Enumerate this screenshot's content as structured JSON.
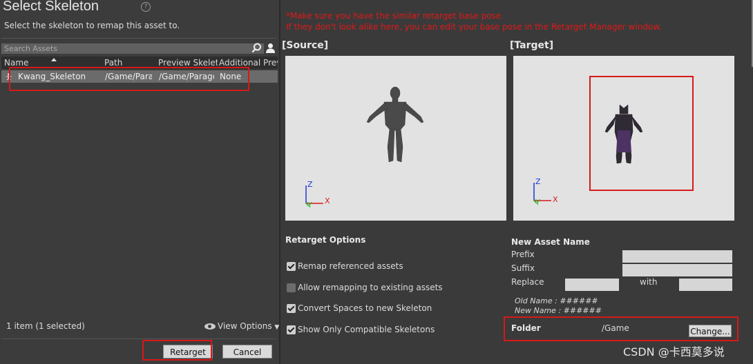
{
  "dialog": {
    "title": "Select Skeleton",
    "help_icon": "help-icon",
    "subtitle": "Select the skeleton to remap this asset to."
  },
  "search": {
    "placeholder": "Search Assets",
    "icon": "search-icon",
    "filter_icon": "person-icon"
  },
  "table": {
    "columns": [
      "Name",
      "Path",
      "Preview Skeleta",
      "Additional Prev"
    ],
    "rows": [
      {
        "name": "Kwang_Skeleton",
        "path": "/Game/Para",
        "preview": "/Game/Parago",
        "additional": "None",
        "selected": true
      }
    ]
  },
  "footer": {
    "count_text": "1 item (1 selected)",
    "view_options": "View Options",
    "retarget": "Retarget",
    "cancel": "Cancel"
  },
  "warnings": [
    "*Make sure you have the similar retarget base pose.",
    "If they don't look alike here, you can edit your base pose in the Retarget Manager window."
  ],
  "source": {
    "label": "[Source]"
  },
  "target": {
    "label": "[Target]"
  },
  "axes": {
    "z": "Z",
    "y": "Y",
    "x": "X"
  },
  "options": {
    "title": "Retarget Options",
    "items": [
      {
        "label": "Remap referenced assets",
        "checked": true
      },
      {
        "label": "Allow remapping to existing assets",
        "checked": false
      },
      {
        "label": "Convert Spaces to new Skeleton",
        "checked": true
      },
      {
        "label": "Show Only Compatible Skeletons",
        "checked": true
      }
    ]
  },
  "new_asset": {
    "title": "New Asset Name",
    "prefix_label": "Prefix",
    "suffix_label": "Suffix",
    "replace_label": "Replace",
    "with_label": "with",
    "old_name": "Old Name : ######",
    "new_name": "New Name : ######"
  },
  "folder": {
    "label": "Folder",
    "value": "/Game",
    "change": "Change..."
  },
  "watermark": "CSDN @卡西莫多说",
  "colors": {
    "highlight": "#d81818",
    "warning": "#e01818"
  }
}
